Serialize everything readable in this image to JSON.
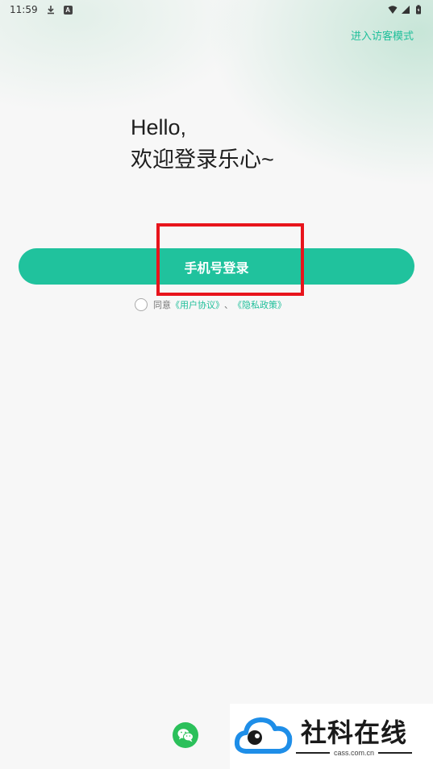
{
  "status_bar": {
    "time": "11:59",
    "download_icon": "download-icon",
    "notification_icon": "a-notification-icon",
    "notification_glyph": "A",
    "wifi_icon": "wifi-icon",
    "signal_icon": "signal-icon",
    "battery_icon": "battery-charging-icon"
  },
  "header": {
    "guest_mode_label": "进入访客模式"
  },
  "greeting": {
    "line1": "Hello,",
    "line2": "欢迎登录乐心~"
  },
  "login": {
    "phone_login_label": "手机号登录"
  },
  "agreement": {
    "prefix": "同意",
    "user_agreement": "《用户协议》",
    "separator": "、",
    "privacy_policy": "《隐私政策》"
  },
  "third_party": {
    "wechat_icon": "wechat-icon"
  },
  "watermark": {
    "title": "社科在线",
    "subtitle": "cass.com.cn"
  },
  "colors": {
    "accent": "#20c29d",
    "link": "#1fbf9a",
    "highlight": "#e8141c",
    "wechat": "#2bc05a",
    "background": "#f7f7f7"
  }
}
